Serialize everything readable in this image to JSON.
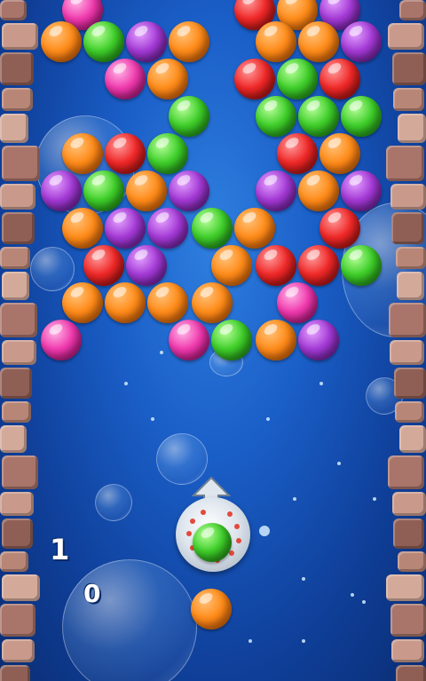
{
  "hud": {
    "count_upper": "1",
    "count_lower": "0"
  },
  "colors": {
    "orange": "#ff8c1a",
    "green": "#3fcf2a",
    "purple": "#a43ad6",
    "red": "#f02828",
    "pink": "#f03aae",
    "water": "#1a5ec7"
  },
  "loaded_bubble": "green",
  "next_bubble": "orange",
  "bubbles": [
    {
      "color": "pink"
    },
    {
      "color": "red"
    },
    {
      "color": "orange"
    },
    {
      "color": "purple"
    },
    {
      "color": "orange"
    },
    {
      "color": "green"
    },
    {
      "color": "purple"
    },
    {
      "color": "orange"
    },
    {
      "color": "orange"
    },
    {
      "color": "orange"
    },
    {
      "color": "purple"
    },
    {
      "color": "pink"
    },
    {
      "color": "orange"
    },
    {
      "color": "red"
    },
    {
      "color": "green"
    },
    {
      "color": "red"
    },
    {
      "color": "green"
    },
    {
      "color": "green"
    },
    {
      "color": "green"
    },
    {
      "color": "green"
    },
    {
      "color": "orange"
    },
    {
      "color": "red"
    },
    {
      "color": "green"
    },
    {
      "color": "red"
    },
    {
      "color": "orange"
    },
    {
      "color": "purple"
    },
    {
      "color": "green"
    },
    {
      "color": "orange"
    },
    {
      "color": "purple"
    },
    {
      "color": "purple"
    },
    {
      "color": "orange"
    },
    {
      "color": "purple"
    },
    {
      "color": "orange"
    },
    {
      "color": "purple"
    },
    {
      "color": "purple"
    },
    {
      "color": "green"
    },
    {
      "color": "orange"
    },
    {
      "color": "red"
    },
    {
      "color": "red"
    },
    {
      "color": "purple"
    },
    {
      "color": "orange"
    },
    {
      "color": "red"
    },
    {
      "color": "red"
    },
    {
      "color": "green"
    },
    {
      "color": "orange"
    },
    {
      "color": "orange"
    },
    {
      "color": "orange"
    },
    {
      "color": "orange"
    },
    {
      "color": "pink"
    },
    {
      "color": "pink"
    },
    {
      "color": "pink"
    },
    {
      "color": "green"
    },
    {
      "color": "orange"
    },
    {
      "color": "purple"
    }
  ]
}
